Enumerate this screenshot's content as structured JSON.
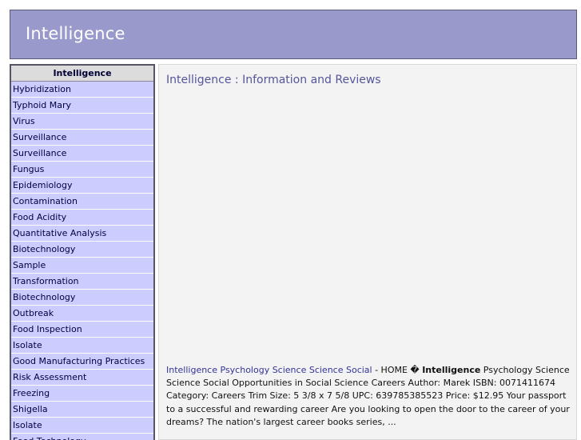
{
  "header": {
    "title": "Intelligence"
  },
  "sidebar": {
    "heading": "Intelligence",
    "items": [
      "Hybridization",
      "Typhoid Mary",
      "Virus",
      "Surveillance",
      "Surveillance",
      "Fungus",
      "Epidemiology",
      "Contamination",
      "Food Acidity",
      "Quantitative Analysis",
      "Biotechnology",
      "Sample",
      "Transformation",
      "Biotechnology",
      "Outbreak",
      "Food Inspection",
      "Isolate",
      "Good Manufacturing Practices",
      "Risk Assessment",
      "Freezing",
      "Shigella",
      "Isolate",
      "Food Technology"
    ]
  },
  "main": {
    "title": "Intelligence : Information and Reviews",
    "result": {
      "link": "Intelligence Psychology Science Science Social",
      "prefix": " - HOME � ",
      "bold": "Intelligence",
      "text": " Psychology Science Science Social Opportunities in Social Science Careers Author: Marek ISBN: 0071411674 Category: Careers Trim Size: 5 3/8 x 7 5/8 UPC: 639785385523 Price: $12.95 Your passport to a successful and rewarding career Are you looking to open the door to the career of your dreams? The nation's largest career books series, ..."
    }
  }
}
